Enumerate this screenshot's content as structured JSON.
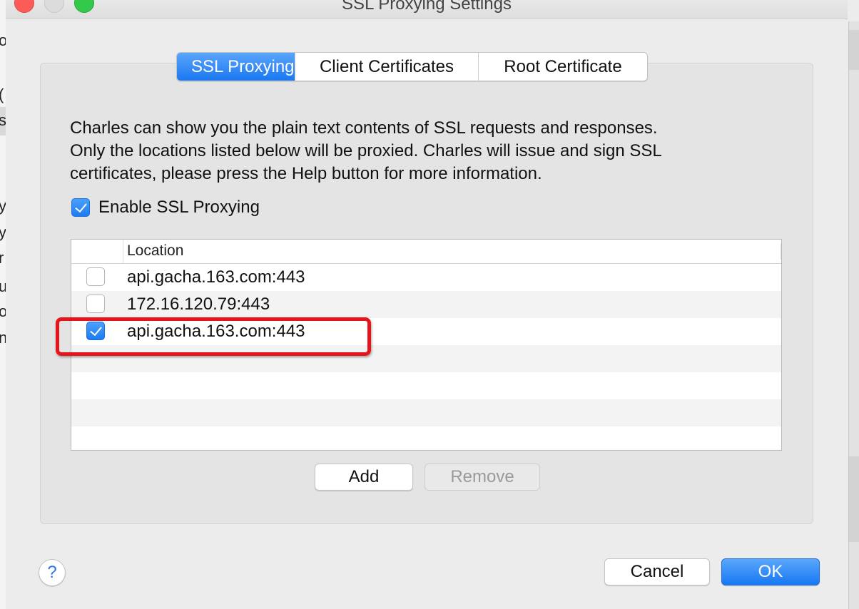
{
  "window": {
    "title": "SSL Proxying Settings"
  },
  "tabs": [
    {
      "label": "SSL Proxying",
      "active": true
    },
    {
      "label": "Client Certificates",
      "active": false
    },
    {
      "label": "Root Certificate",
      "active": false
    }
  ],
  "description": {
    "lines": [
      "Charles can show you the plain text contents of SSL requests and responses.",
      "Only the locations listed below will be proxied. Charles will issue and sign SSL",
      "certificates, please press the Help button for more information."
    ]
  },
  "enable_ssl": {
    "label": "Enable SSL Proxying",
    "checked": true
  },
  "table": {
    "column_header": "Location",
    "rows": [
      {
        "location": "api.gacha.163.com:443",
        "checked": false
      },
      {
        "location": "172.16.120.79:443",
        "checked": false
      },
      {
        "location": "api.gacha.163.com:443",
        "checked": true
      }
    ]
  },
  "buttons": {
    "add": "Add",
    "remove": "Remove",
    "cancel": "Cancel",
    "ok": "OK",
    "help": "?"
  },
  "background_fragments": [
    "o",
    "(",
    "s",
    "y",
    "y",
    "r",
    "u.",
    "o",
    "n"
  ],
  "colors": {
    "accent": "#1a78f2",
    "highlight_annotation": "#e6151b"
  }
}
